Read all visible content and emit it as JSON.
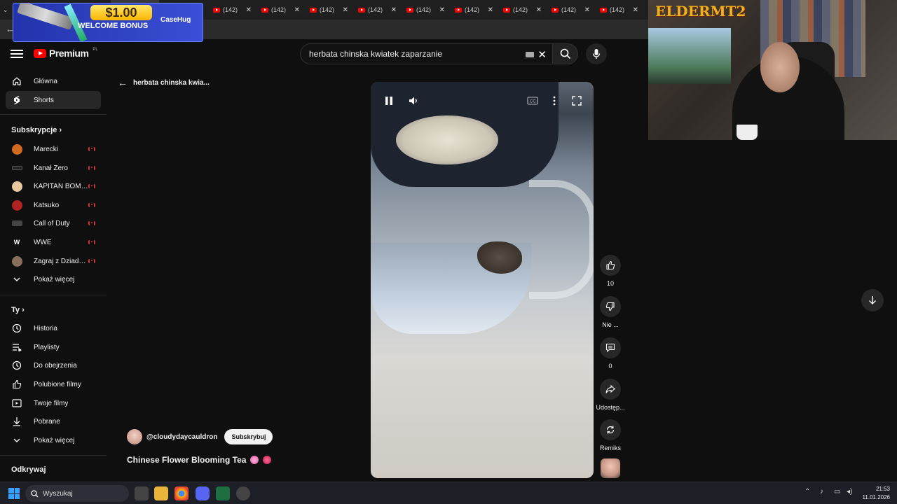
{
  "browser": {
    "tabs": [
      {
        "label": "(142)"
      },
      {
        "label": "(142)"
      },
      {
        "label": "(1-"
      },
      {
        "label": "(142)"
      },
      {
        "label": "(142)"
      },
      {
        "label": "(142)"
      },
      {
        "label": "(142)"
      },
      {
        "label": "(142)"
      },
      {
        "label": "(142)"
      },
      {
        "label": "(142)"
      },
      {
        "label": "(142)"
      },
      {
        "label": "(142)"
      },
      {
        "label": "(142)"
      }
    ]
  },
  "ad": {
    "amount": "$1.00",
    "bonus": "WELCOME BONUS",
    "brand": "CaseHug"
  },
  "header": {
    "logo_text": "Premium",
    "logo_country": "PL",
    "search_value": "herbata chinska kwiatek  zaparzanie"
  },
  "sidebar": {
    "main": [
      {
        "label": "Główna",
        "icon": "home-icon"
      },
      {
        "label": "Shorts",
        "icon": "shorts-icon"
      }
    ],
    "subs_heading": "Subskrypcje",
    "subs": [
      {
        "label": "Marecki",
        "color": "#d2691e"
      },
      {
        "label": "Kanał Zero",
        "color": "#222222"
      },
      {
        "label": "KAPITAN BOMB...",
        "color": "#e8c9a0"
      },
      {
        "label": "Katsuko",
        "color": "#b22222"
      },
      {
        "label": "Call of Duty",
        "color": "#333333"
      },
      {
        "label": "WWE",
        "color": "#111111"
      },
      {
        "label": "Zagraj z Dziadkie...",
        "color": "#8a6e5c"
      }
    ],
    "show_more": "Pokaż więcej",
    "you_heading": "Ty",
    "you": [
      {
        "label": "Historia",
        "icon": "history-icon"
      },
      {
        "label": "Playlisty",
        "icon": "playlist-icon"
      },
      {
        "label": "Do obejrzenia",
        "icon": "watch-later-icon"
      },
      {
        "label": "Polubione filmy",
        "icon": "like-icon"
      },
      {
        "label": "Twoje filmy",
        "icon": "your-videos-icon"
      },
      {
        "label": "Pobrane",
        "icon": "download-icon"
      }
    ],
    "show_more_2": "Pokaż więcej",
    "explore_heading": "Odkrywaj"
  },
  "main": {
    "back_label": "herbata chinska kwia...",
    "channel_handle": "@cloudydaycauldron",
    "subscribe_label": "Subskrybuj",
    "title": "Chinese Flower Blooming Tea"
  },
  "actions": {
    "like_count": "10",
    "dislike_label": "Nie ...",
    "comments_count": "0",
    "share_label": "Udostęp...",
    "remix_label": "Remiks"
  },
  "webcam": {
    "overlay_text": "ELDERMT2"
  },
  "taskbar": {
    "search_placeholder": "Wyszukaj",
    "time": "21:53",
    "date": "11.01.2026"
  }
}
